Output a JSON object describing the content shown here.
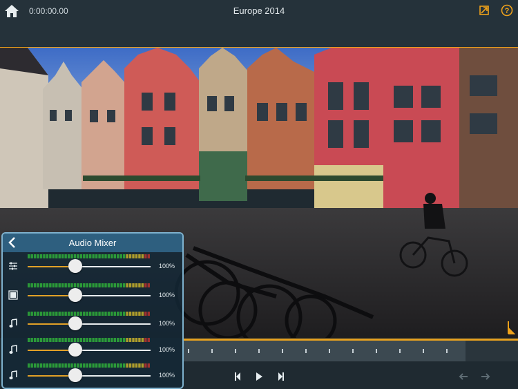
{
  "header": {
    "timecode": "0:00:00.00",
    "project_title": "Europe 2014",
    "icons": [
      "home-icon",
      "export-icon",
      "help-icon"
    ]
  },
  "colors": {
    "accent": "#f0a21a",
    "panel_border": "#7fb2ce",
    "meter_green": "#2fae3a"
  },
  "mixer": {
    "title": "Audio Mixer",
    "channels": [
      {
        "icon": "master-mixer-icon",
        "level": 0.39,
        "level_text": "100%"
      },
      {
        "icon": "video-track-icon",
        "level": 0.39,
        "level_text": "100%"
      },
      {
        "icon": "music-note-icon",
        "level": 0.39,
        "level_text": "100%"
      },
      {
        "icon": "music-note-icon",
        "level": 0.39,
        "level_text": "100%"
      },
      {
        "icon": "music-note-icon",
        "level": 0.39,
        "level_text": "100%"
      }
    ]
  },
  "transport": {
    "icons": [
      "previous-frame-icon",
      "play-icon",
      "next-frame-icon",
      "undo-icon",
      "redo-icon"
    ]
  }
}
